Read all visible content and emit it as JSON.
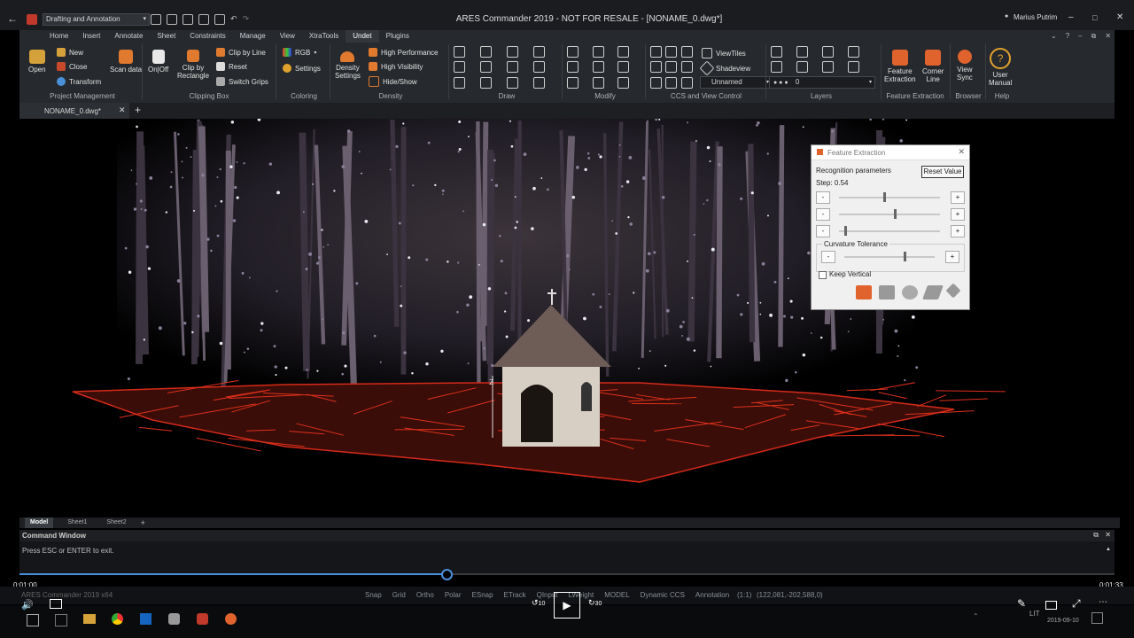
{
  "window": {
    "workspace": "Drafting and Annotation",
    "title": "ARES Commander 2019 - NOT FOR RESALE - [NONAME_0.dwg*]",
    "user": "Marius Putrim"
  },
  "ribbon": {
    "tabs": [
      "Home",
      "Insert",
      "Annotate",
      "Sheet",
      "Constraints",
      "Manage",
      "View",
      "XtraTools",
      "Undet",
      "Plugins"
    ],
    "active_tab": "Undet",
    "groups": {
      "project_management": {
        "label": "Project Management",
        "open": "Open",
        "new": "New",
        "close": "Close",
        "transform": "Transform",
        "scan_data": "Scan data"
      },
      "clipping_box": {
        "label": "Clipping Box",
        "on_off": "On|Off",
        "clip_by_rectangle": "Clip by\nRectangle",
        "clip_by_line": "Clip by Line",
        "reset": "Reset",
        "switch_grips": "Switch Grips"
      },
      "coloring": {
        "label": "Coloring",
        "rgb": "RGB",
        "settings": "Settings"
      },
      "density": {
        "label": "Density",
        "density_settings": "Density\nSettings",
        "high_performance": "High Performance",
        "high_visibility": "High Visibility",
        "hide_show": "Hide/Show"
      },
      "draw": {
        "label": "Draw"
      },
      "modify": {
        "label": "Modify"
      },
      "ccs": {
        "label": "CCS and View Control",
        "view_tiles": "ViewTiles",
        "shadeview": "Shadeview",
        "view_select": "Unnamed"
      },
      "layers": {
        "label": "Layers",
        "layer_value": "0"
      },
      "feature_extraction": {
        "label": "Feature Extraction",
        "feature": "Feature\nExtraction",
        "corner": "Corner\nLine"
      },
      "browser": {
        "label": "Browser",
        "view_sync": "View\nSync"
      },
      "help": {
        "label": "Help",
        "manual": "User\nManual"
      }
    }
  },
  "doc_tab": {
    "name": "NONAME_0.dwg*"
  },
  "dialog": {
    "title": "Feature Extraction",
    "section": "Recognition parameters",
    "reset": "Reset Value",
    "step": "Step: 0.54",
    "sliders": [
      0.45,
      0.55,
      0.05
    ],
    "curvature_label": "Curvature Tolerance",
    "curvature": 0.6,
    "keep_vertical": "Keep Vertical",
    "minus": "-",
    "plus": "+"
  },
  "layouts": [
    "Model",
    "Sheet1",
    "Sheet2"
  ],
  "add_tab": "+",
  "command": {
    "title": "Command Window",
    "text": "Press ESC or ENTER to exit."
  },
  "video": {
    "current": "0:01:00",
    "total": "0:01:33",
    "progress": 0.39,
    "back": "10",
    "fwd": "30"
  },
  "status": {
    "app": "ARES Commander 2019 x64",
    "items": [
      "Snap",
      "Grid",
      "Ortho",
      "Polar",
      "ESnap",
      "ETrack",
      "QInput",
      "LWeight",
      "MODEL",
      "Dynamic CCS",
      "Annotation"
    ],
    "scale": "(1:1)",
    "coords": "(122,081,-202,588,0)"
  },
  "clock": {
    "lang": "LIT",
    "date": "2019-09-10"
  }
}
